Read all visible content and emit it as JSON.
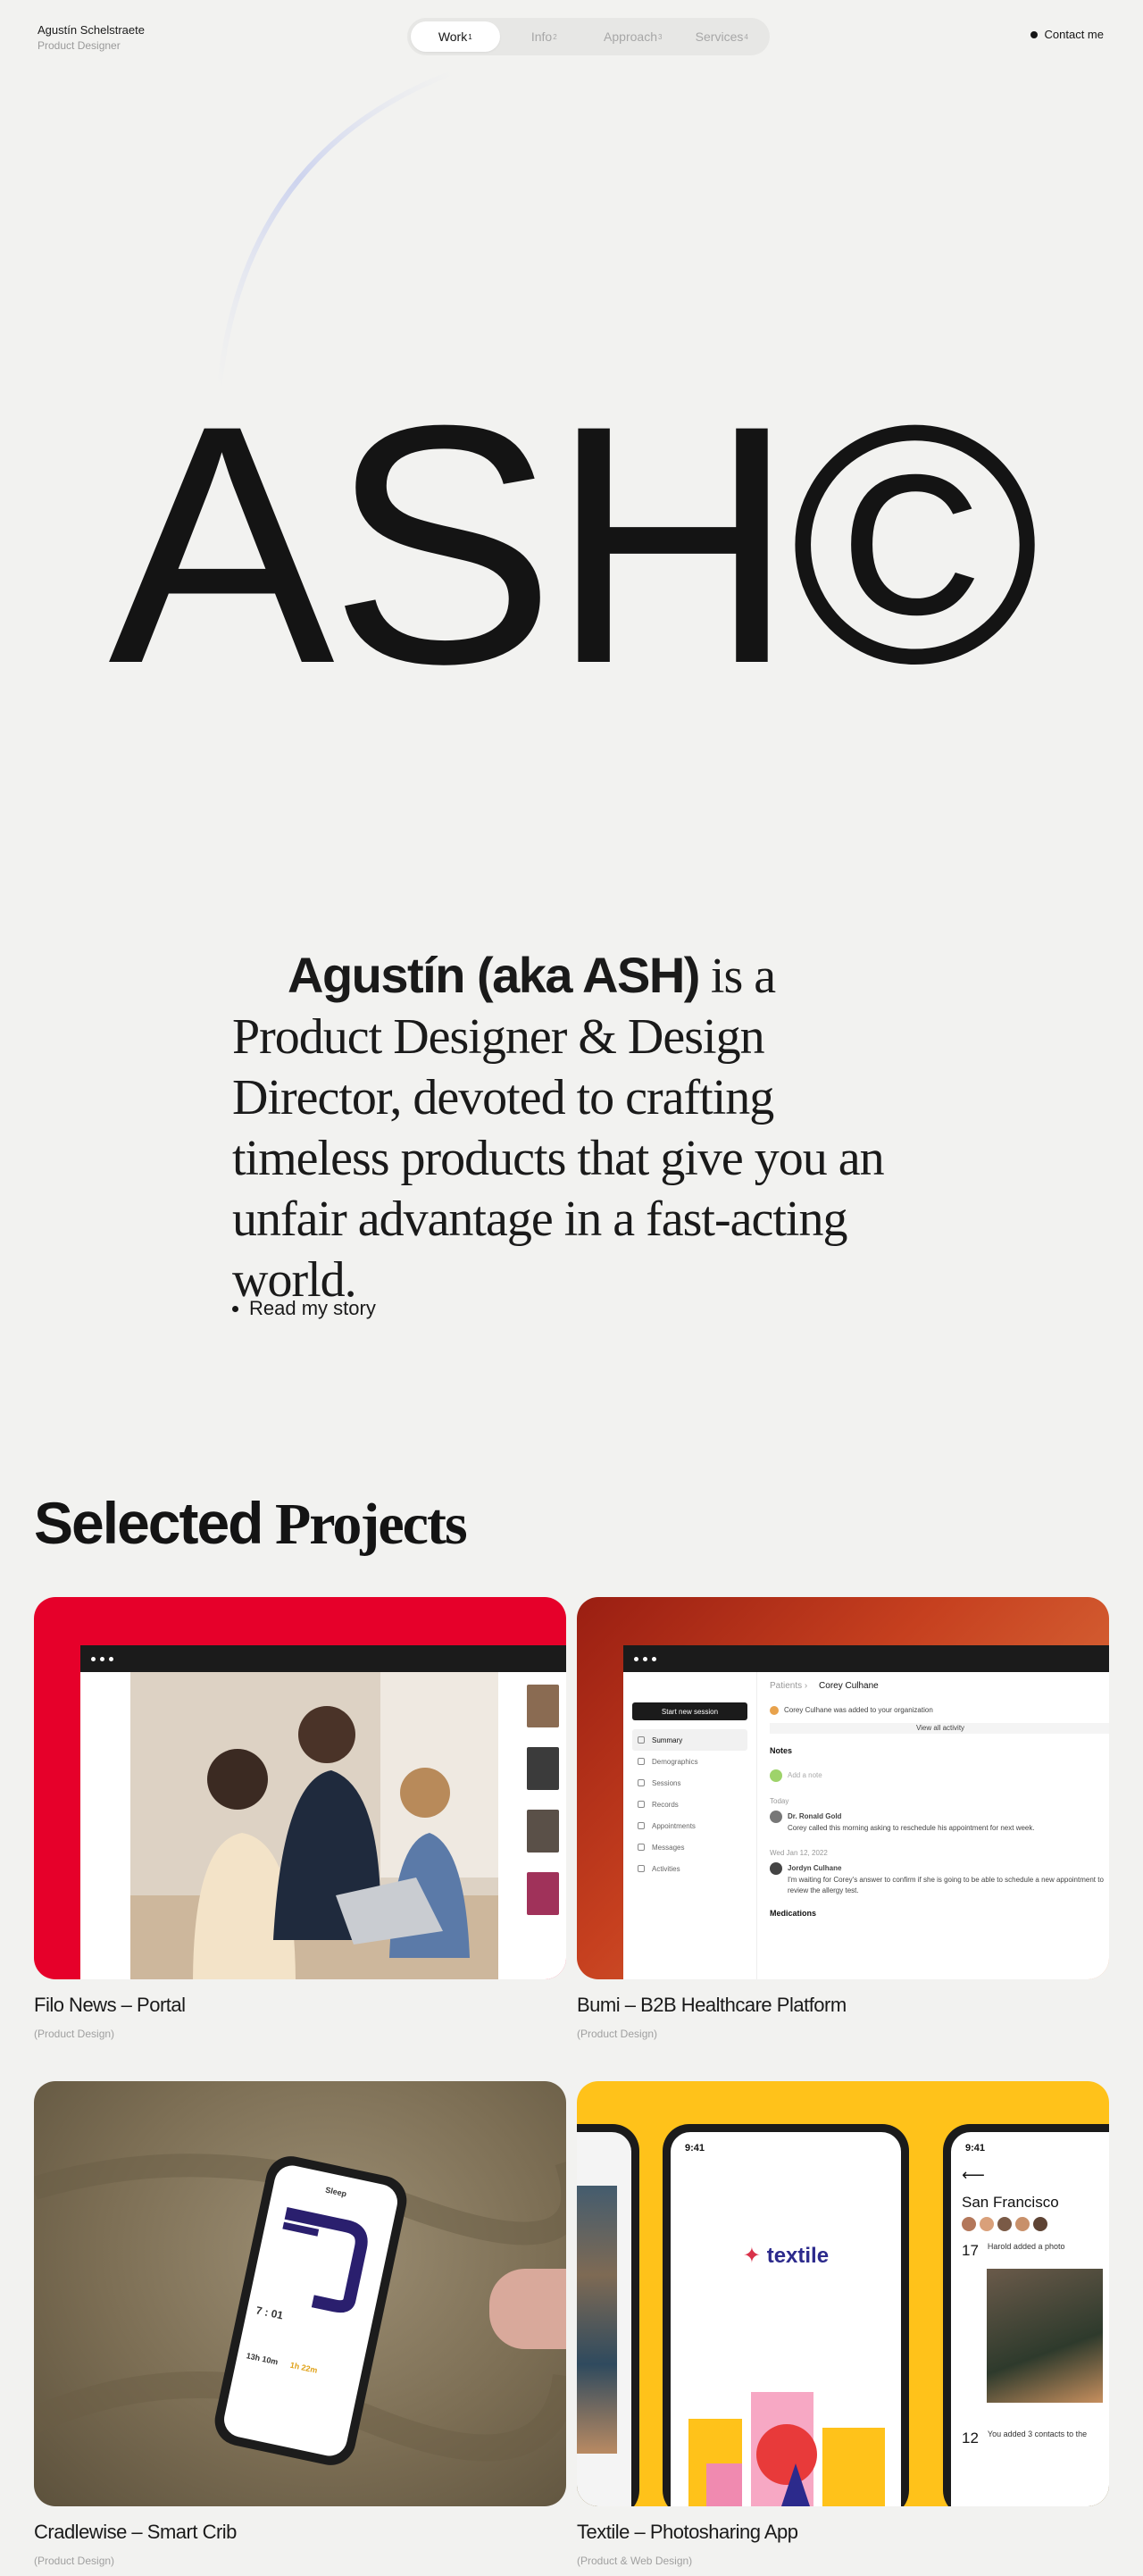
{
  "header": {
    "name": "Agustín Schelstraete",
    "role": "Product Designer",
    "nav": [
      {
        "label": "Work",
        "sup": "1"
      },
      {
        "label": "Info",
        "sup": "2"
      },
      {
        "label": "Approach",
        "sup": "3"
      },
      {
        "label": "Services",
        "sup": "4"
      }
    ],
    "contact": "Contact me"
  },
  "hero": {
    "title": "ASH©"
  },
  "intro": {
    "bold": "Agustín (aka ASH)",
    "text": " is a Product Designer & Design Director, devoted to crafting timeless products that give you an unfair advantage in a fast-acting world.",
    "link": "Read my story"
  },
  "projects": {
    "title_bold": "Selected",
    "title_serif": " Projects",
    "items": [
      {
        "title": "Filo News – Portal",
        "tag": "(Product Design)"
      },
      {
        "title": "Bumi – B2B Healthcare Platform",
        "tag": "(Product Design)"
      },
      {
        "title": "Cradlewise – Smart Crib",
        "tag": "(Product Design)"
      },
      {
        "title": "Textile – Photosharing App",
        "tag": "(Product & Web Design)"
      }
    ]
  },
  "bumi": {
    "crumb_root": "Patients",
    "crumb_leaf": "Corey Culhane",
    "start_btn": "Start new session",
    "menu": [
      "Summary",
      "Demographics",
      "Sessions",
      "Records",
      "Appointments",
      "Messages",
      "Activities"
    ],
    "notice": "Corey Culhane was added to your organization",
    "view_all": "View all activity",
    "notes": "Notes",
    "add_note": "Add a note",
    "today": "Today",
    "author1": "Dr. Ronald Gold",
    "note1": "Corey called this morning asking to reschedule his appointment for next week.",
    "date2": "Wed Jan 12, 2022",
    "author2": "Jordyn Culhane",
    "note2": "I'm waiting for Corey's answer to confirm if she is going to be able to schedule a new appointment to review the allergy test.",
    "medications": "Medications"
  },
  "cradle": {
    "screen_title": "Sleep",
    "sleep_time": "7 : 01",
    "total": "13h 10m",
    "awake": "1h 22m"
  },
  "textile": {
    "time": "9:41",
    "logo": "textile",
    "city": "San Francisco",
    "day1": "17",
    "note1": "Harold added a photo",
    "day2": "12",
    "note2": "You added 3 contacts to the"
  },
  "colors": {
    "filo": "#e6002a",
    "textile": "#ffc21a",
    "accent_navy": "#2c2a8c"
  }
}
